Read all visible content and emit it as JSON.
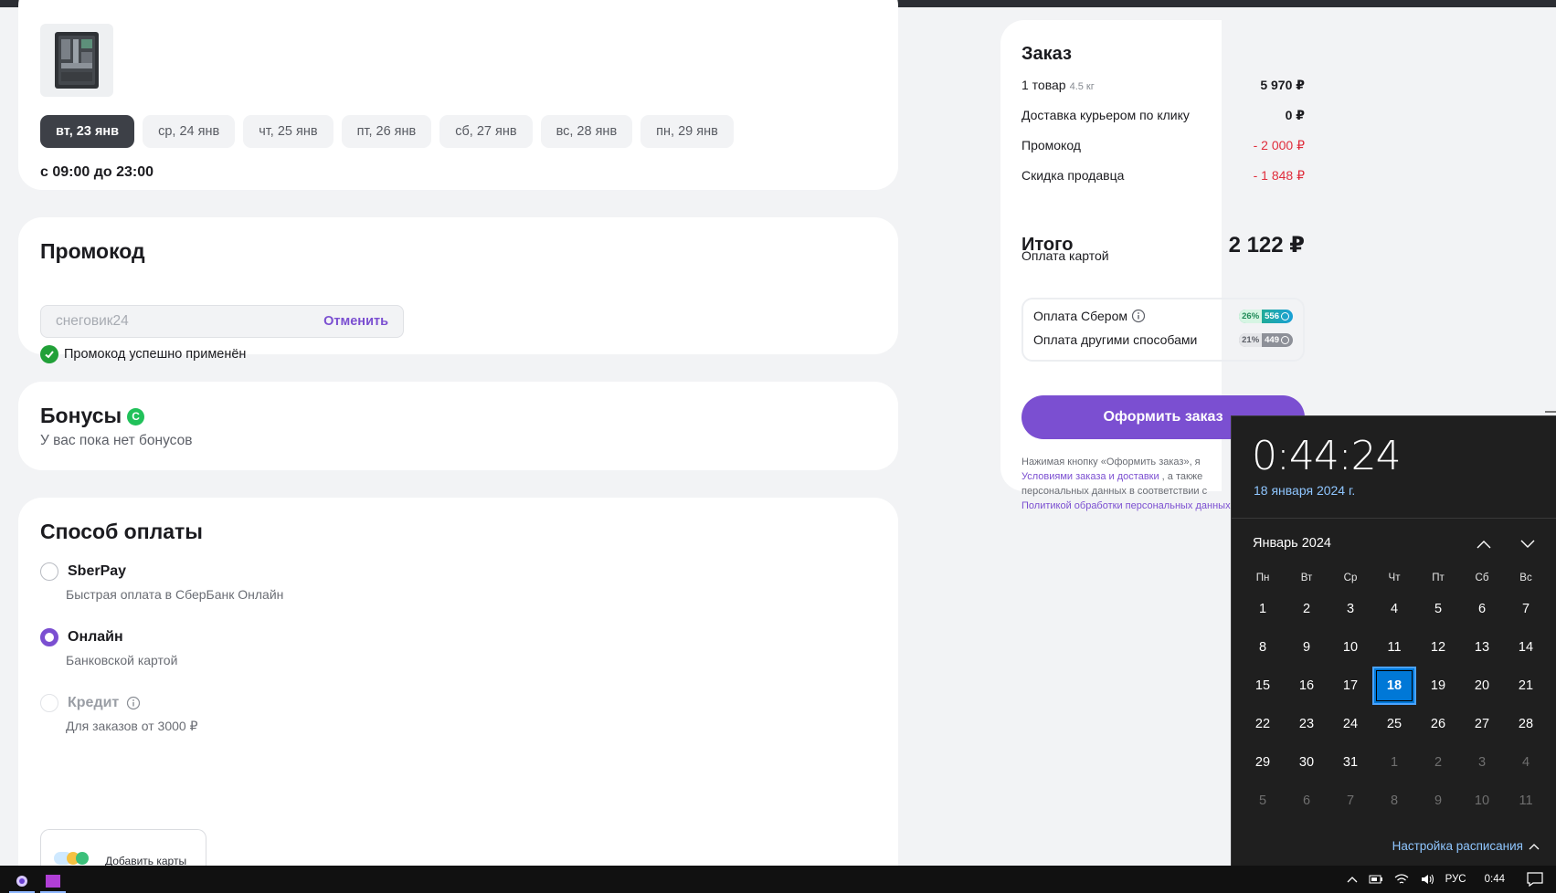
{
  "delivery": {
    "product_image_alt": "набор инструментов",
    "dates": [
      "вт, 23 янв",
      "ср, 24 янв",
      "чт, 25 янв",
      "пт, 26 янв",
      "сб, 27 янв",
      "вс, 28 янв",
      "пн, 29 янв"
    ],
    "selected_date_index": 0,
    "time_range": "с 09:00 до 23:00"
  },
  "promo": {
    "title": "Промокод",
    "code_value": "снеговик24",
    "cancel_label": "Отменить",
    "success_text": "Промокод успешно применён"
  },
  "bonuses": {
    "title": "Бонусы",
    "badge_icon": "sber-spasibo-icon",
    "empty_text": "У вас пока нет бонусов"
  },
  "payment": {
    "title": "Способ оплаты",
    "options": [
      {
        "label": "SberPay",
        "sub": "Быстрая оплата в СберБанк Онлайн",
        "selected": false,
        "disabled": false
      },
      {
        "label": "Онлайн",
        "sub": "Банковской картой",
        "selected": true,
        "disabled": false
      },
      {
        "label": "Кредит",
        "sub": "Для заказов от 3000 ₽",
        "selected": false,
        "disabled": true
      }
    ],
    "add_card_label": "Добавить карты"
  },
  "summary": {
    "title": "Заказ",
    "items_label": "1 товар",
    "items_weight": "4.5 кг",
    "items_value": "5 970 ₽",
    "delivery_label": "Доставка курьером по клику",
    "delivery_value": "0 ₽",
    "promo_label": "Промокод",
    "promo_value": "- 2 000 ₽",
    "seller_discount_label": "Скидка продавца",
    "seller_discount_value": "- 1 848 ₽",
    "total_label": "Итого",
    "total_value": "2 122 ₽",
    "pay_method": "Оплата картой",
    "bonus_rows": [
      {
        "label": "Оплата Сбером",
        "percent": "26%",
        "amount": "556"
      },
      {
        "label": "Оплата другими способами",
        "percent": "21%",
        "amount": "449"
      }
    ],
    "order_button": "Оформить заказ",
    "legal_line1": "Нажимая кнопку «Оформить заказ», я",
    "legal_link1": "Условиями заказа и доставки",
    "legal_line2_tail": " , а также",
    "legal_line3": "персональных данных в соответствии с",
    "legal_link2": "Политикой обработки персональных данных"
  },
  "calendar_flyout": {
    "time": "0:44:24",
    "date": "18 января 2024 г.",
    "month": "Январь 2024",
    "weekdays": [
      "Пн",
      "Вт",
      "Ср",
      "Чт",
      "Пт",
      "Сб",
      "Вс"
    ],
    "days": [
      [
        "1",
        "2",
        "3",
        "4",
        "5",
        "6",
        "7"
      ],
      [
        "8",
        "9",
        "10",
        "11",
        "12",
        "13",
        "14"
      ],
      [
        "15",
        "16",
        "17",
        "18",
        "19",
        "20",
        "21"
      ],
      [
        "22",
        "23",
        "24",
        "25",
        "26",
        "27",
        "28"
      ],
      [
        "29",
        "30",
        "31",
        "1",
        "2",
        "3",
        "4"
      ],
      [
        "5",
        "6",
        "7",
        "8",
        "9",
        "10",
        "11"
      ]
    ],
    "today": "18",
    "schedule_label": "Настройка расписания"
  },
  "taskbar": {
    "language": "РУС",
    "time": "0:44"
  },
  "colors": {
    "accent": "#7b4fd1",
    "negative": "#e02d3c",
    "success": "#21a038",
    "calendar_today": "#0078d7"
  }
}
